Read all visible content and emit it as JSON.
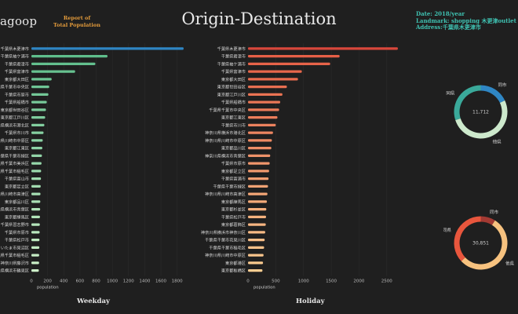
{
  "header": {
    "logo": "agoop",
    "report_line1": "Report of",
    "report_line2": "Total Population",
    "title": "Origin-Destination",
    "date": "Date: 2018/year",
    "landmark": "Landmark: shopping 木更津outlet",
    "address": "Address:千葉県木更津市"
  },
  "footer": {
    "weekday": "Weekday",
    "holiday": "Holiday"
  },
  "colors": {
    "top_bar_weekday": "#2f86c4",
    "top_bar_holiday": "#d8473b"
  },
  "chart_data": [
    {
      "type": "bar",
      "orientation": "horizontal",
      "xlabel": "population",
      "xlim": [
        0,
        1900
      ],
      "xticks": [
        0,
        200,
        400,
        600,
        800,
        1000,
        1200,
        1400,
        1600,
        1800
      ],
      "categories": [
        "千葉県木更津市",
        "千葉県袖ケ浦市",
        "千葉県君津市",
        "千葉県富津市",
        "東京都大田区",
        "千葉県千葉市中央区",
        "千葉県市原市",
        "千葉県船橋市",
        "東京都世田谷区",
        "東京都江戸川区",
        "神奈川県横浜市港北区",
        "千葉県市川市",
        "神奈川県川崎市中原区",
        "東京都江東区",
        "千葉県千葉市緑区",
        "千葉県千葉市美浜区",
        "千葉県千葉市稲毛区",
        "千葉県富山市",
        "東京都足立区",
        "神奈川県川崎市高津区",
        "東京都品川区",
        "神奈川県横浜市青葉区",
        "東京都練馬区",
        "千葉県習志野市",
        "千葉県市原市",
        "千葉県松戸市",
        "さいたま市見沼区",
        "千葉県千葉市稲毛区",
        "神奈川県藤沢市",
        "神奈川県横浜市鶴見区"
      ],
      "values": [
        1880,
        940,
        790,
        540,
        250,
        220,
        210,
        190,
        180,
        170,
        160,
        150,
        140,
        135,
        130,
        125,
        120,
        118,
        115,
        112,
        110,
        108,
        106,
        104,
        102,
        100,
        98,
        96,
        95,
        92
      ]
    },
    {
      "type": "bar",
      "orientation": "horizontal",
      "xlabel": "population",
      "xlim": [
        0,
        2800
      ],
      "xticks": [
        0,
        500,
        1000,
        1500,
        2000,
        2500
      ],
      "categories": [
        "千葉県木更津市",
        "千葉県君津市",
        "千葉県袖ケ浦市",
        "千葉県富津市",
        "東京都大田区",
        "東京都世田谷区",
        "東京都江戸川区",
        "千葉県船橋市",
        "千葉県千葉市中央区",
        "東京都江東区",
        "千葉県市川市",
        "神奈川県横浜市港北区",
        "神奈川県川崎市中原区",
        "東京都品川区",
        "神奈川県横浜市青葉区",
        "千葉県市原市",
        "東京都足立区",
        "千葉県富浦市",
        "千葉県千葉市緑区",
        "神奈川県川崎市高津区",
        "東京都練馬区",
        "東京都杉並区",
        "千葉県松戸市",
        "東京都葛飾区",
        "神奈川県横浜市神奈川区",
        "千葉県千葉市花見川区",
        "千葉県千葉市稲毛区",
        "神奈川県川崎市中原区",
        "東京都港区",
        "東京都板橋区"
      ],
      "values": [
        2700,
        1650,
        1480,
        970,
        900,
        700,
        620,
        580,
        560,
        530,
        500,
        450,
        430,
        420,
        400,
        390,
        380,
        370,
        360,
        350,
        340,
        330,
        325,
        320,
        310,
        300,
        290,
        280,
        270,
        260
      ]
    },
    {
      "type": "pie",
      "donut": true,
      "center_label": "11,712",
      "labels": [
        "同市",
        "他県",
        "同県"
      ],
      "values": [
        18,
        52,
        30
      ],
      "colors": [
        "#2f86c4",
        "#cde9cc",
        "#3aa99a"
      ]
    },
    {
      "type": "pie",
      "donut": true,
      "center_label": "30,851",
      "labels": [
        "同市",
        "他県",
        "同県"
      ],
      "values": [
        9,
        54,
        37
      ],
      "colors": [
        "#a33a33",
        "#f7c27f",
        "#e8563d"
      ]
    }
  ]
}
